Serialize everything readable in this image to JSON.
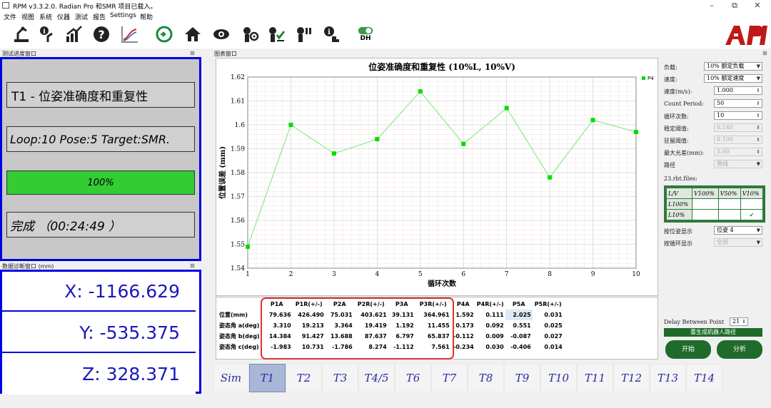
{
  "window": {
    "title": "RPM v3.3.2.0. Radian Pro 和SMR  项目已载入。",
    "minimize": "–",
    "maximize": "⧉",
    "close": "✕"
  },
  "menu": [
    "文件",
    "视图",
    "系统",
    "仪器",
    "测试",
    "报告",
    "Settings",
    "帮助"
  ],
  "toolbar": {
    "icons": [
      "robot-config-icon",
      "robot-info-icon",
      "chart-up-icon",
      "help-icon",
      "curve-icon",
      "refresh-icon",
      "home-icon",
      "eye-icon",
      "robot-settings-icon",
      "robot-check-icon",
      "robot-pause-icon",
      "robot-info2-icon",
      "dh-toggle-icon"
    ],
    "dh_label": "DH",
    "logo": "API"
  },
  "progress_panel": {
    "title": "测试进度窗口",
    "close": "⊠",
    "test_name": "T1 - 位姿准确度和重复性",
    "loop_info": "Loop:10 Pose:5  Target:SMR.",
    "progress_text": "100%",
    "progress_value": 1.0,
    "status": "完成  （00:24:49 ）"
  },
  "diag_panel": {
    "title": "数据诊断窗口 (mm)",
    "close": "⊠",
    "x": "X: -1166.629",
    "y": "Y: -535.375",
    "z": "Z: 328.371"
  },
  "chart_panel": {
    "title": "图表窗口",
    "close": "⊠"
  },
  "chart_data": {
    "type": "line",
    "title": "位姿准确度和重复性 (10%L, 10%V)",
    "xlabel": "循环次数",
    "ylabel": "位置误差 (mm)",
    "x": [
      1,
      2,
      3,
      4,
      5,
      6,
      7,
      8,
      9,
      10
    ],
    "series": [
      {
        "name": "P4",
        "values": [
          1.549,
          1.6,
          1.588,
          1.594,
          1.614,
          1.592,
          1.607,
          1.578,
          1.602,
          1.597
        ]
      }
    ],
    "xlim": [
      1,
      10
    ],
    "ylim": [
      1.54,
      1.62
    ],
    "yticks": [
      "1.54",
      "1.55",
      "1.56",
      "1.57",
      "1.58",
      "1.59",
      "1.6",
      "1.61",
      "1.62"
    ],
    "xticks": [
      "1",
      "2",
      "3",
      "4",
      "5",
      "6",
      "7",
      "8",
      "9",
      "10"
    ],
    "grid": true,
    "legend": "top-right",
    "line_color": "#90ee90",
    "marker_color": "#00dd00"
  },
  "results_table": {
    "headers": [
      "P1A",
      "P1R(+/-)",
      "P2A",
      "P2R(+/-)",
      "P3A",
      "P3R(+/-)",
      "P4A",
      "P4R(+/-)",
      "P5A",
      "P5R(+/-)"
    ],
    "rows": [
      {
        "label": "位置(mm)",
        "values": [
          "79.636",
          "426.490",
          "75.031",
          "403.621",
          "39.131",
          "364.961",
          "1.592",
          "0.111",
          "2.025",
          "0.031"
        ]
      },
      {
        "label": "姿态角 a(deg)",
        "values": [
          "3.310",
          "19.213",
          "3.364",
          "19.419",
          "1.192",
          "11.455",
          "0.173",
          "0.092",
          "0.551",
          "0.025"
        ]
      },
      {
        "label": "姿态角 b(deg)",
        "values": [
          "14.384",
          "91.427",
          "13.688",
          "87.637",
          "6.797",
          "65.837",
          "-0.112",
          "0.009",
          "-0.087",
          "0.027"
        ]
      },
      {
        "label": "姿态角 c(deg)",
        "values": [
          "-1.983",
          "10.731",
          "-1.786",
          "8.274",
          "-1.112",
          "7.561",
          "-0.234",
          "0.030",
          "-0.406",
          "0.014"
        ]
      }
    ],
    "highlight_color": "#e03030"
  },
  "controls": {
    "load_label": "负载:",
    "load_value": "10% 额定负载",
    "speed_label": "速度:",
    "speed_value": "10% 额定速度",
    "speed_mm_label": "速度(m/s):",
    "speed_mm_value": "1.000",
    "count_period_label": "Count Period:",
    "count_period_value": "50",
    "cycles_label": "循环次数:",
    "cycles_value": "10",
    "stable_label": "稳定阈值:",
    "stable_value": "0.140",
    "dwell_label": "驻留阈值:",
    "dwell_value": "0.100",
    "max_dev_label": "最大允差(mm):",
    "max_dev_value": "5.00",
    "path_label": "路径",
    "path_value": "直线",
    "files_label": "23.rbt.files:",
    "grid_headers": [
      "L/V",
      "V100%",
      "V50%",
      "V10%"
    ],
    "grid_rows": [
      "L100%",
      "L10%"
    ],
    "grid_check": "✔",
    "pose_display_label": "按位姿显示",
    "pose_display_value": "位姿 4",
    "cycle_display_label": "按循环显示",
    "cycle_display_value": "全部",
    "delay_label": "Delay Between Point",
    "delay_value": "21",
    "regen_label": "重生成机器人路径",
    "start_label": "开始",
    "analyze_label": "分析"
  },
  "tabs": [
    "Sim",
    "T1",
    "T2",
    "T3",
    "T4/5",
    "T6",
    "T7",
    "T8",
    "T9",
    "T10",
    "T11",
    "T12",
    "T13",
    "T14"
  ],
  "active_tab": "T1"
}
